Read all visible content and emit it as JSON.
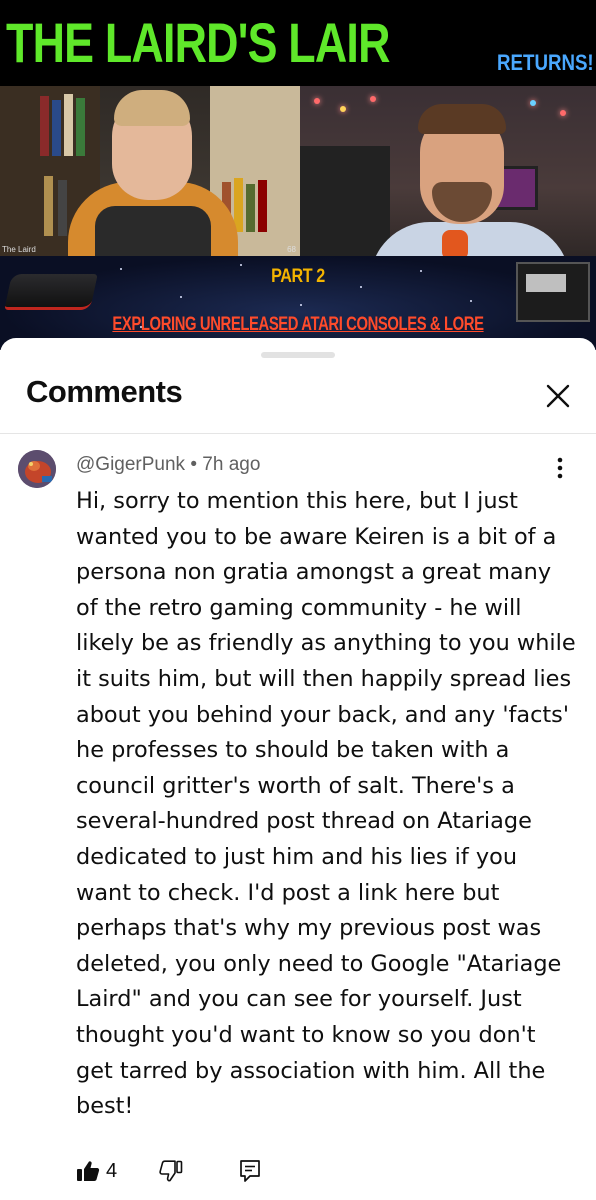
{
  "video": {
    "title": "THE LAIRD'S LAIR",
    "title_suffix": "RETURNS!",
    "cam_left_caption": "The Laird",
    "cam_left_number": "68",
    "part_label": "PART 2",
    "part_subtitle": "EXPLORING UNRELEASED ATARI CONSOLES & LORE"
  },
  "comments_panel": {
    "title": "Comments",
    "close_icon": "close-icon"
  },
  "comment": {
    "author": "@GigerPunk",
    "separator": " • ",
    "time": "7h ago",
    "text": "Hi, sorry to mention this here, but I just wanted you to be aware Keiren is a bit of a persona non gratia amongst a great many of the retro gaming community - he will likely be as friendly as anything to you while it suits him, but will then happily spread lies about you behind your back, and any 'facts' he professes to should be taken with a council gritter's worth of salt. There's a several-hundred post thread on Atariage dedicated to just him and his lies if you want to check. I'd post a link here but perhaps that's why my previous post was deleted, you only need to Google \"Atariage Laird\" and you can see for yourself. Just thought you'd want to know so you don't get tarred by association with him. All the best!",
    "like_count": "4",
    "icons": {
      "more": "more-vertical-icon",
      "like": "thumbs-up-filled-icon",
      "dislike": "thumbs-down-icon",
      "reply": "reply-comment-icon"
    }
  },
  "colors": {
    "title_green": "#5fe82a",
    "title_blue": "#4aa8ff",
    "part_yellow": "#f4b400",
    "part_red": "#ff4b2b",
    "text_primary": "#0f0f0f",
    "text_secondary": "#606060"
  }
}
